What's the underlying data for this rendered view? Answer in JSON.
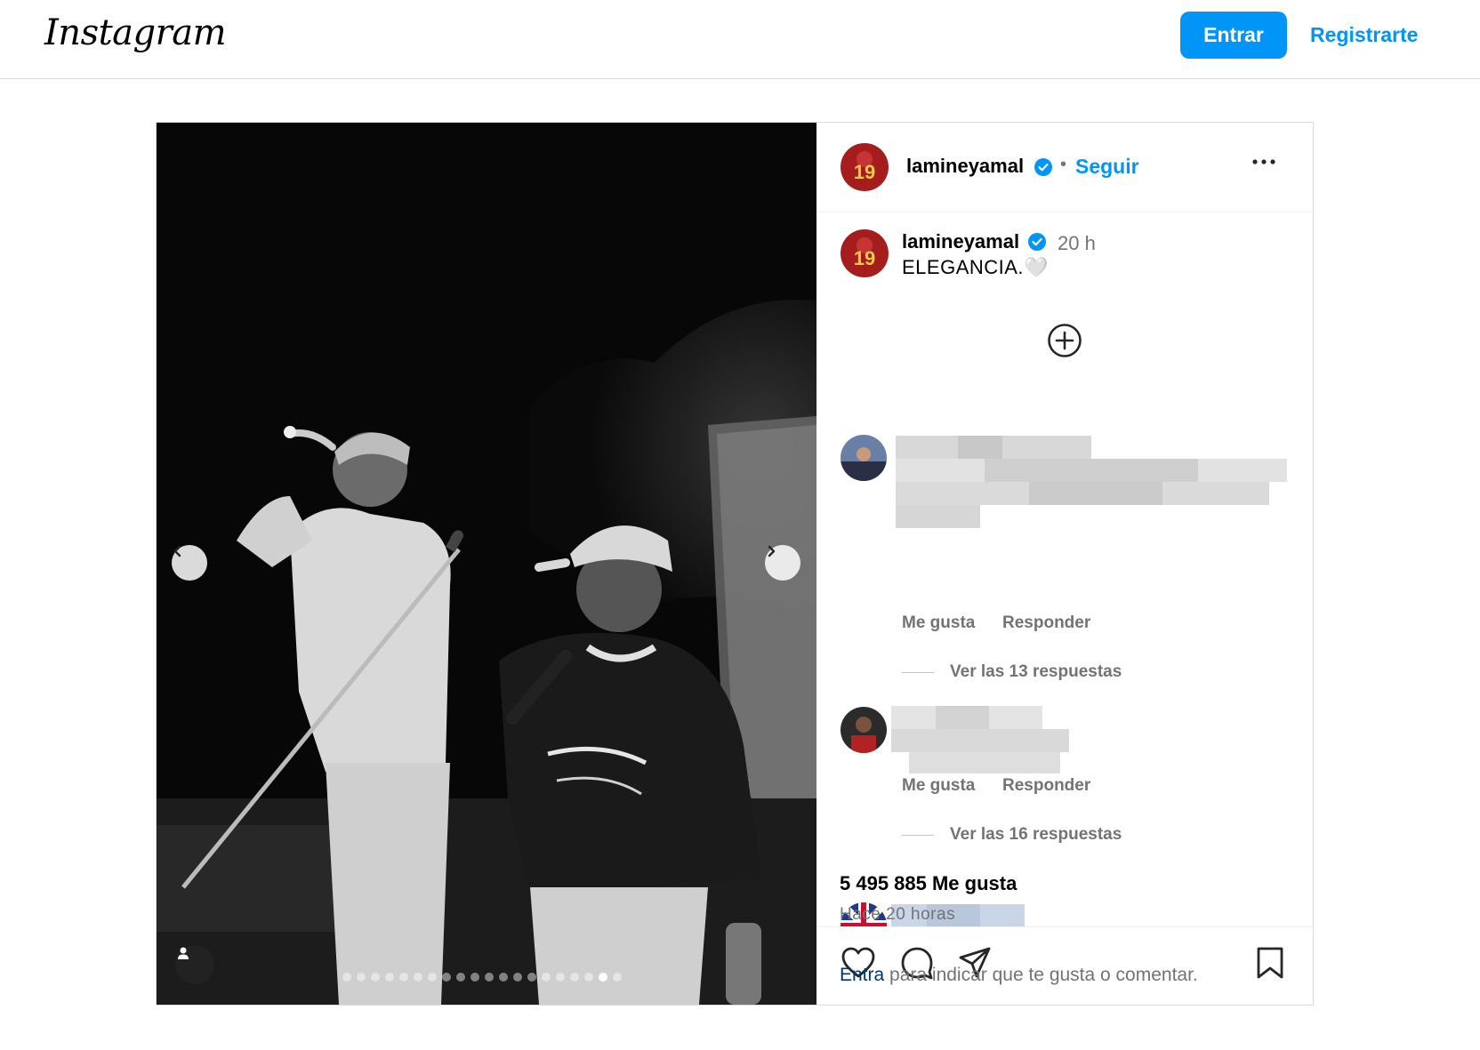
{
  "header": {
    "logo": "Instagram",
    "login_button": "Entrar",
    "signup_link": "Registrarte"
  },
  "post": {
    "author": "lamineyamal",
    "follow_label": "Seguir",
    "separator": "•",
    "caption_author": "lamineyamal",
    "caption_time": "20 h",
    "caption_text": "ELEGANCIA.🤍",
    "carousel": {
      "total_slides": 20,
      "active_slide": 19
    },
    "comments": [
      {
        "like_label": "Me gusta",
        "reply_label": "Responder",
        "view_replies": "Ver las 13 respuestas"
      },
      {
        "like_label": "Me gusta",
        "reply_label": "Responder",
        "view_replies": "Ver las 16 respuestas"
      }
    ],
    "likes": "5 495 885 Me gusta",
    "time_ago": "Hace 20 horas",
    "login_prompt_link": "Entra",
    "login_prompt_text": " para indicar que te gusta o comentar."
  },
  "icons": {
    "verified": "verified-badge-icon",
    "more": "more-options-icon",
    "plus": "plus-circle-icon",
    "like": "heart-icon",
    "comment": "comment-icon",
    "share": "share-icon",
    "save": "bookmark-icon",
    "prev": "chevron-left-icon",
    "next": "chevron-right-icon",
    "tag": "user-tag-icon"
  },
  "colors": {
    "accent": "#0095f6",
    "muted": "#737373",
    "border": "#dbdbdb"
  }
}
